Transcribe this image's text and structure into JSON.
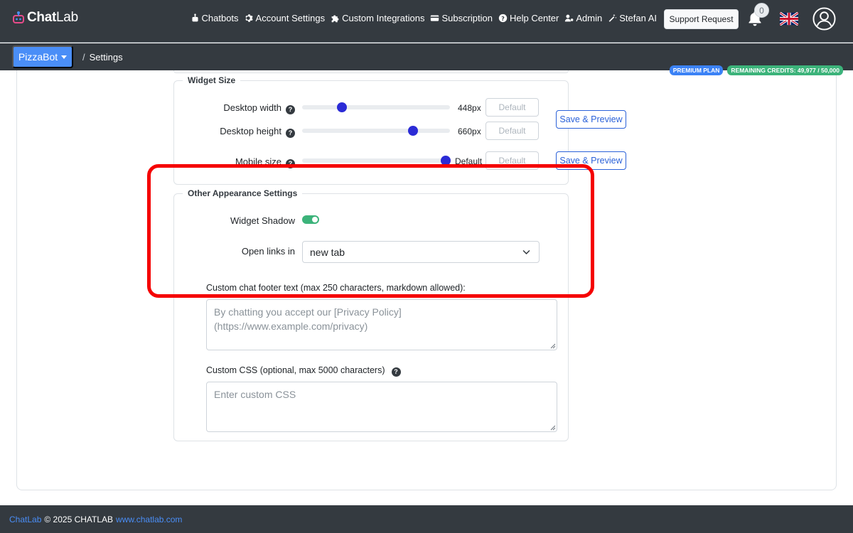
{
  "app": {
    "logo_bold": "Chat",
    "logo_light": "Lab"
  },
  "nav": {
    "links": [
      {
        "label": "Chatbots",
        "icon": "robot-icon"
      },
      {
        "label": "Account Settings",
        "icon": "gear-icon"
      },
      {
        "label": "Custom Integrations",
        "icon": "puzzle-icon"
      },
      {
        "label": "Subscription",
        "icon": "credit-card-icon"
      },
      {
        "label": "Help Center",
        "icon": "question-circle-icon"
      },
      {
        "label": "Admin",
        "icon": "user-cog-icon"
      },
      {
        "label": "Stefan AI",
        "icon": "magic-wand-icon"
      }
    ],
    "support_label": "Support Request",
    "notifications_count": "0"
  },
  "subbar": {
    "bot_name": "PizzaBot",
    "breadcrumb_sep": "/",
    "breadcrumb_page": "Settings"
  },
  "badges": {
    "plan": "PREMIUM PLAN",
    "credits": "REMAINING CREDITS: 49,977 / 50,000",
    "plan_color": "#3b82f6",
    "credits_color": "#3cb37a"
  },
  "widget_size": {
    "legend": "Widget Size",
    "rows": [
      {
        "label": "Desktop width",
        "value": "448px",
        "fraction": 0.27,
        "default_label": "Default"
      },
      {
        "label": "Desktop height",
        "value": "660px",
        "fraction": 0.75,
        "default_label": "Default"
      },
      {
        "label": "Mobile size",
        "value": "Default",
        "fraction": 0.97,
        "default_label": "Default"
      }
    ],
    "save_label": "Save & Preview"
  },
  "other_appearance": {
    "legend": "Other Appearance Settings",
    "shadow_label": "Widget Shadow",
    "shadow_on": true,
    "open_links_label": "Open links in",
    "open_links_value": "new tab",
    "footer_text_label": "Custom chat footer text (max 250 characters, markdown allowed):",
    "footer_text_placeholder": "By chatting you accept our [Privacy Policy] (https://www.example.com/privacy)",
    "css_label": "Custom CSS (optional, max 5000 characters)",
    "css_placeholder": "Enter custom CSS"
  },
  "footer": {
    "brand": "ChatLab",
    "copyright": "© 2025 CHATLAB",
    "site": "www.chatlab.com"
  },
  "colors": {
    "nav_bg": "#343a40",
    "primary": "#4a8ef7",
    "slider_thumb": "#2b2bd6",
    "highlight": "#f50000"
  }
}
